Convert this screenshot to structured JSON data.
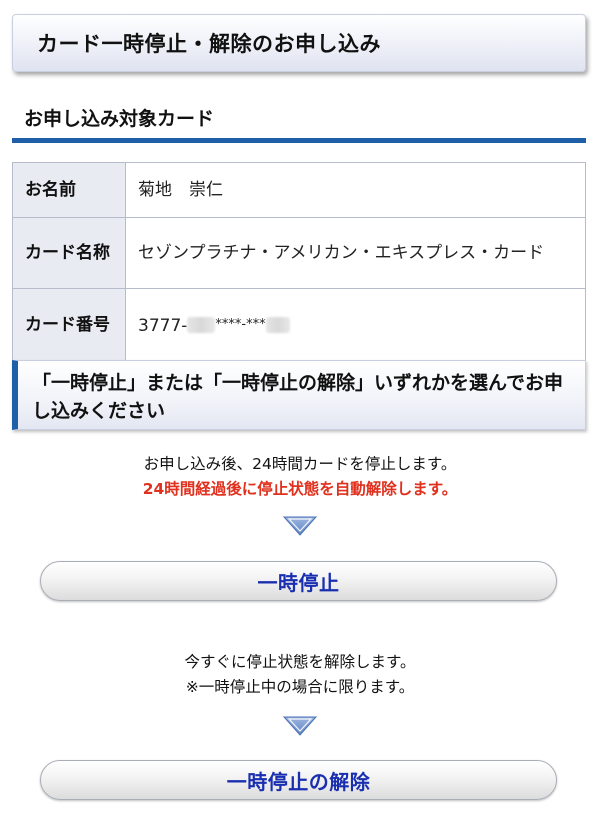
{
  "header": {
    "title": "カード一時停止・解除のお申し込み"
  },
  "target_card": {
    "section_title": "お申し込み対象カード",
    "rows": [
      {
        "label": "お名前",
        "value": "菊地　崇仁"
      },
      {
        "label": "カード名称",
        "value": "セゾンプラチナ・アメリカン・エキスプレス・カード"
      },
      {
        "label": "カード番号",
        "value_prefix": "3777-",
        "value_masked": "****-***"
      }
    ]
  },
  "choose": {
    "text": "「一時停止」または「一時停止の解除」いずれかを選んでお申し込みください"
  },
  "suspend": {
    "desc_line1": "お申し込み後、24時間カードを停止します。",
    "desc_line2": "24時間経過後に停止状態を自動解除します。",
    "button_label": "一時停止"
  },
  "release": {
    "desc_line1": "今すぐに停止状態を解除します。",
    "desc_line2": "※一時停止中の場合に限ります。",
    "button_label": "一時停止の解除"
  },
  "colors": {
    "accent_blue": "#1f5fa8",
    "button_text": "#1a2fb0",
    "warning_red": "#e0301e",
    "arrow_fill": "#7f9fd0"
  }
}
